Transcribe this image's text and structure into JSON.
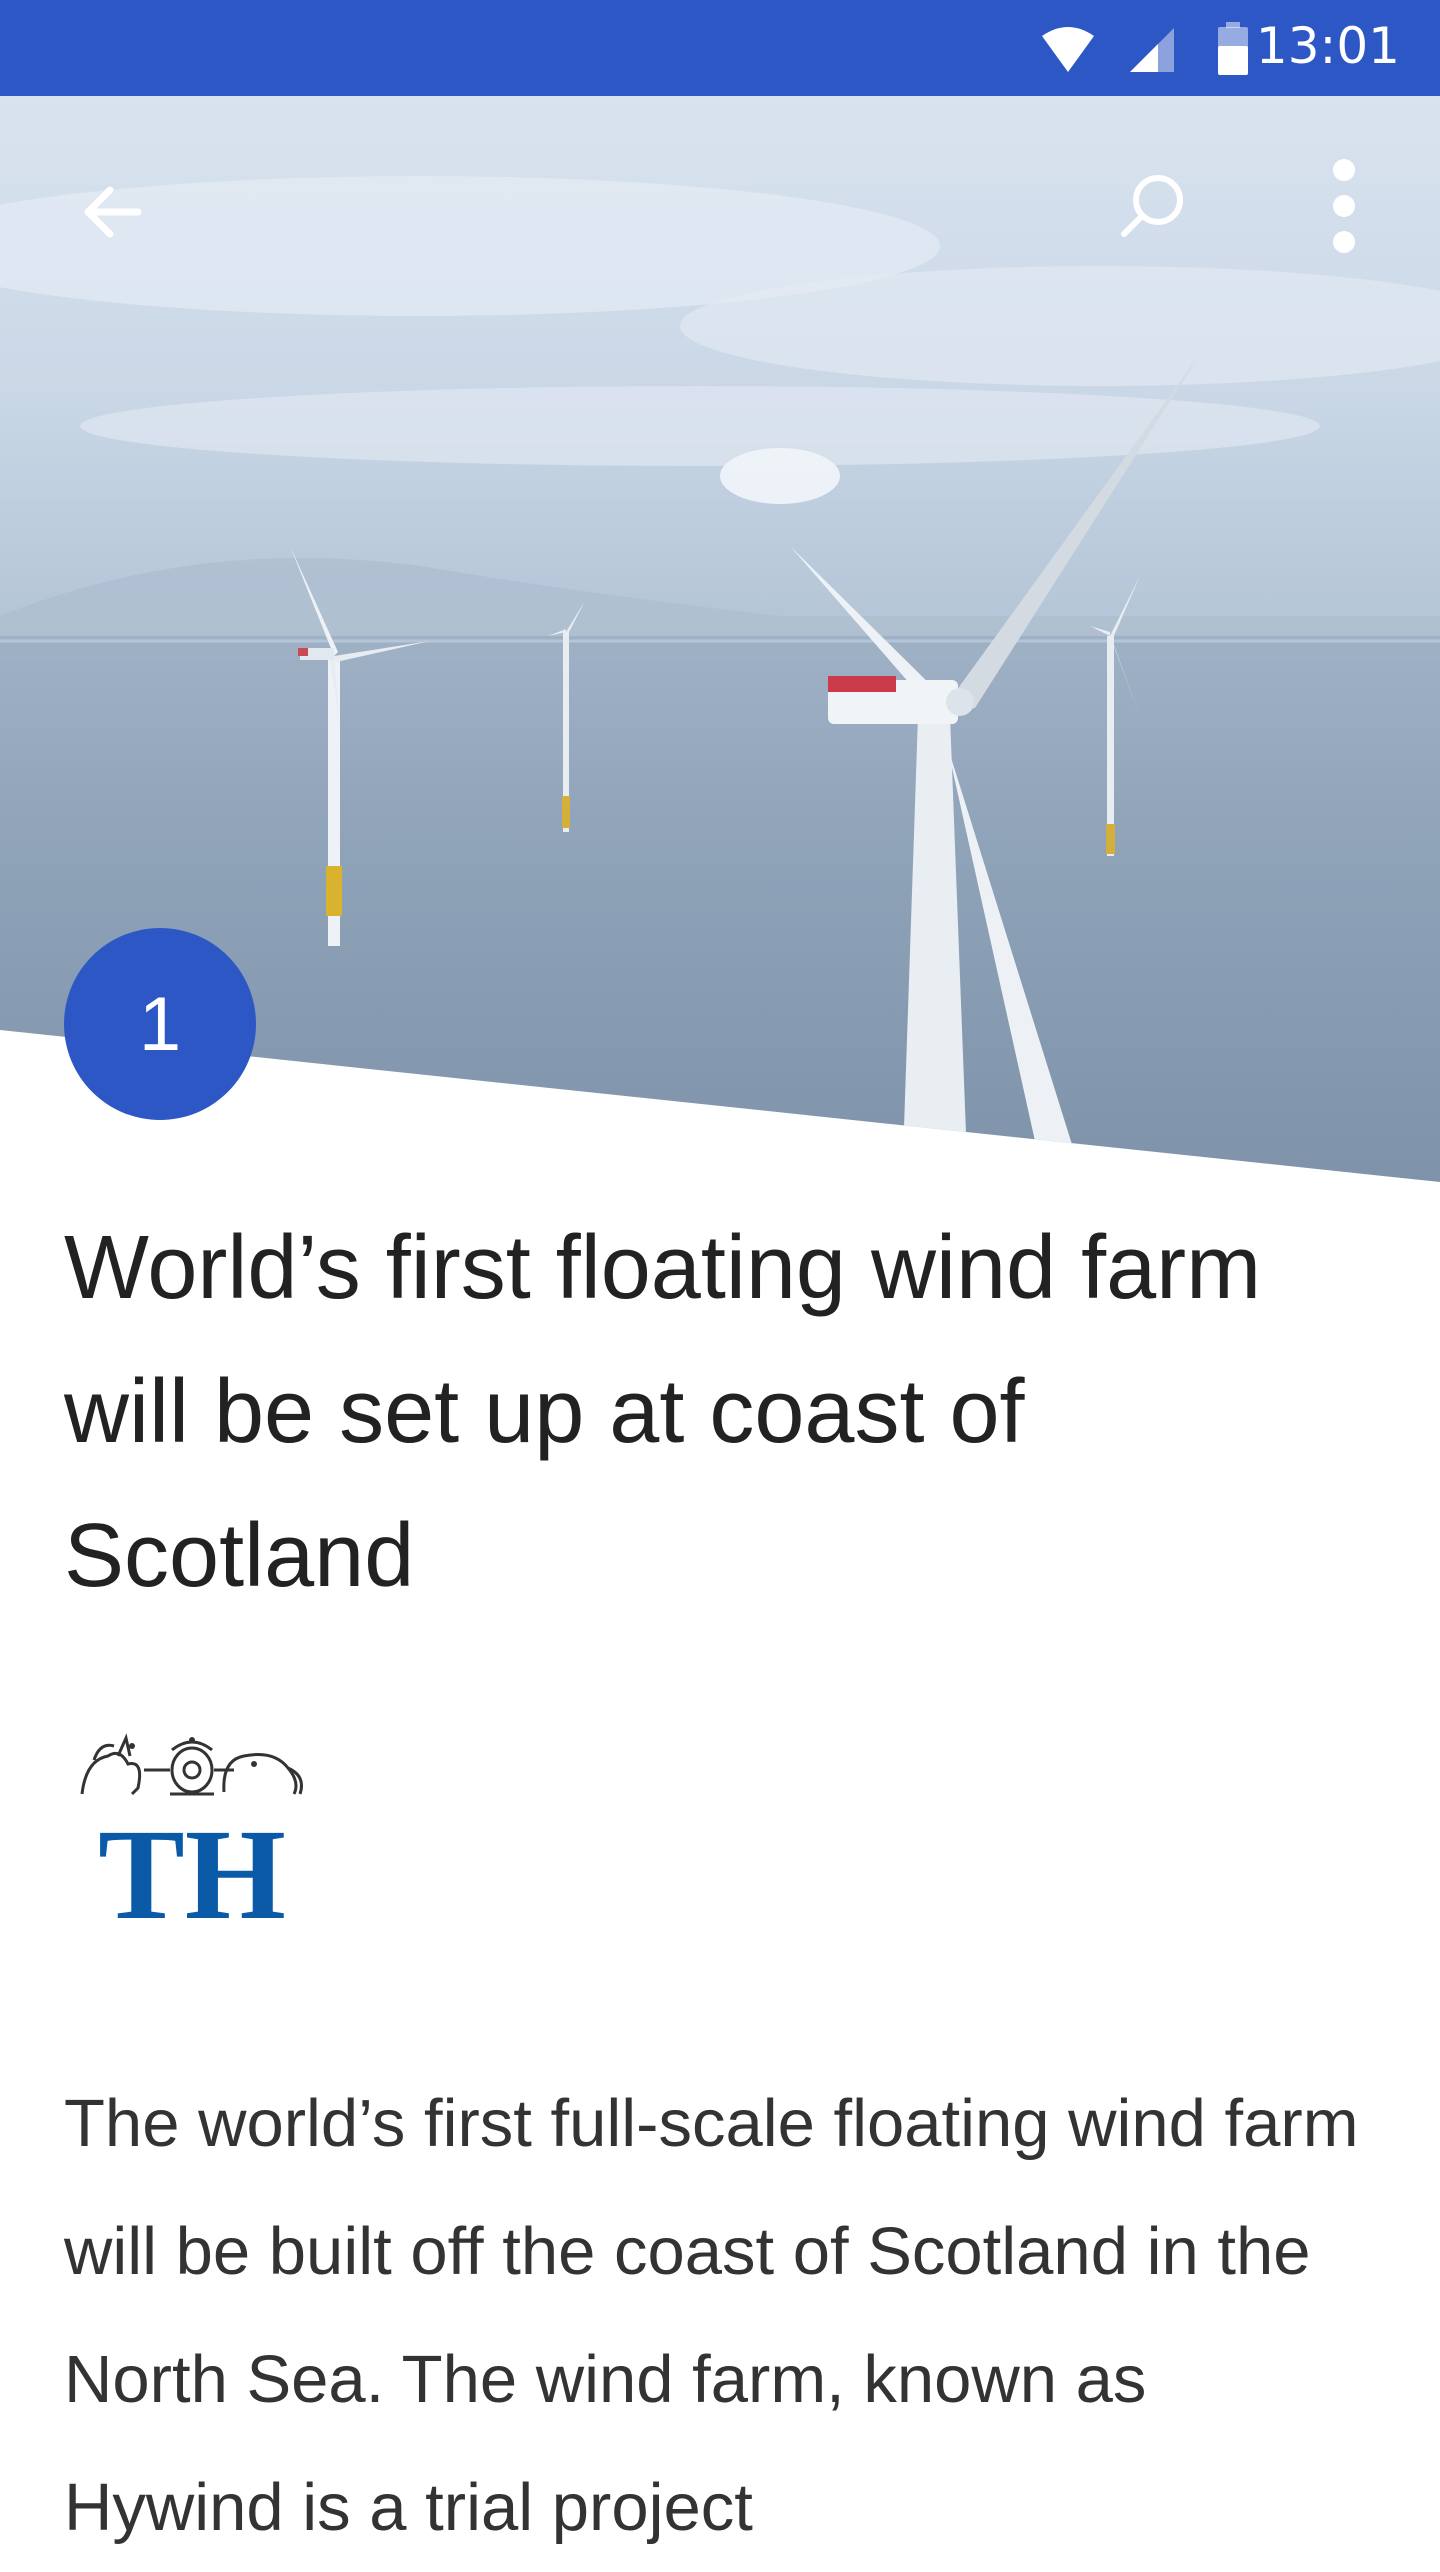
{
  "status_bar": {
    "time": "13:01",
    "icons": [
      "wifi-icon",
      "cellular-signal-icon",
      "battery-icon"
    ],
    "color": "#2c57c5"
  },
  "toolbar": {
    "back_icon": "arrow-back-icon",
    "search_icon": "search-icon",
    "more_icon": "more-vertical-icon"
  },
  "article": {
    "rank": "1",
    "headline": "World’s first floating wind farm will be set up at coast of Scotland",
    "source_logo_text": "TH",
    "source_logo_color": "#0a5aa8",
    "body": "The world’s first full-scale floating wind farm will be built off the coast of Scotland in the North Sea. The wind farm, known as Hywind is a trial project"
  },
  "colors": {
    "accent": "#2c57c5",
    "headline": "#222222",
    "body": "#333333"
  }
}
